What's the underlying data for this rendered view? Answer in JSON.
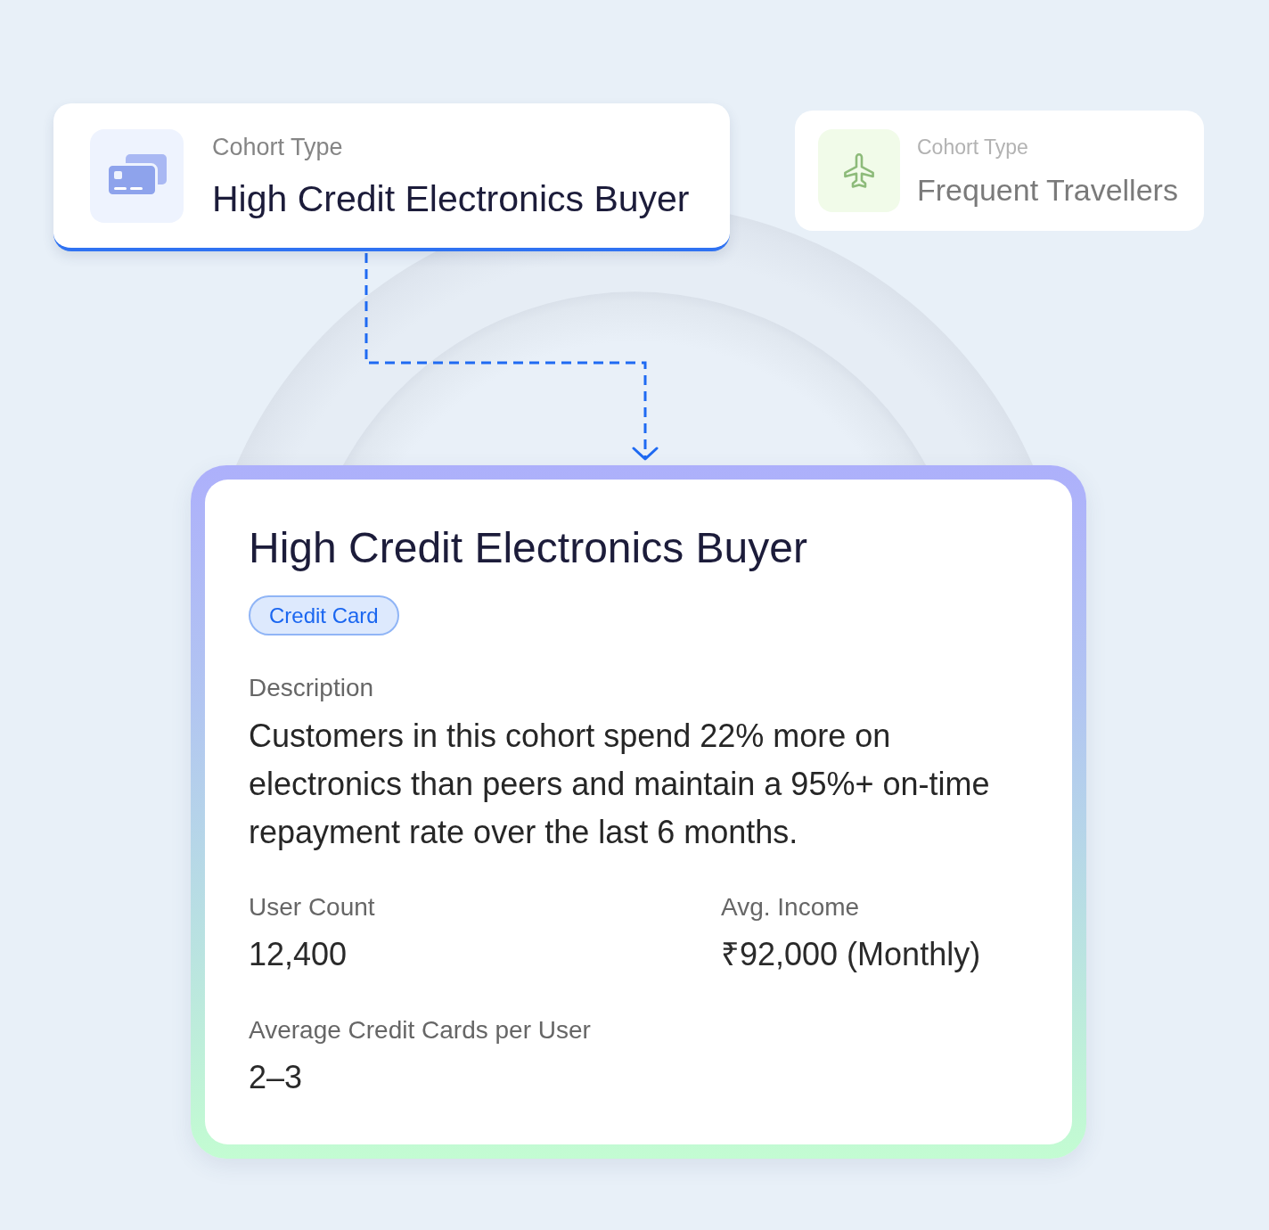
{
  "cohort_cards": [
    {
      "label": "Cohort Type",
      "name": "High Credit Electronics Buyer",
      "kind": "credit-card",
      "selected": true
    },
    {
      "label": "Cohort Type",
      "name": "Frequent Travellers",
      "kind": "plane",
      "selected": false
    }
  ],
  "detail_card": {
    "title": "High Credit Electronics Buyer",
    "tag": "Credit Card",
    "description_label": "Description",
    "description": "Customers in this cohort spend 22% more on electronics than peers and maintain a 95%+ on-time repayment rate over the last 6 months.",
    "stats": [
      {
        "label": "User Count",
        "value": "12,400"
      },
      {
        "label": "Avg. Income",
        "value": "₹92,000 (Monthly)"
      },
      {
        "label": "Average Credit Cards per User",
        "value": "2–3"
      }
    ]
  }
}
